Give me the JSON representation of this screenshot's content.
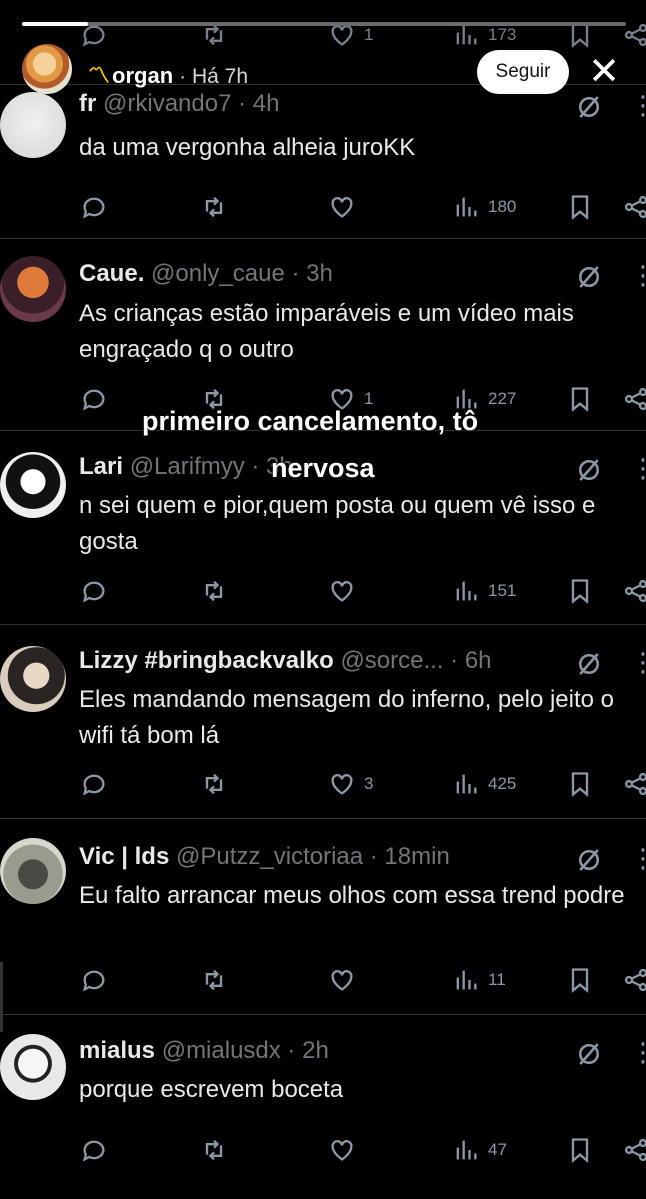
{
  "story": {
    "progress": 0.11,
    "user": "organ",
    "time": "· Há 7h",
    "follow": "Seguir",
    "close": "✕"
  },
  "top_partial": {
    "likes": "1",
    "views": "173"
  },
  "overlay": {
    "line1": "primeiro cancelamento, tô",
    "line2": "nervosa"
  },
  "tweets": [
    {
      "name": "fr",
      "handle": "@rkivando7 · 4h",
      "text": "da uma vergonha alheia juroKK",
      "likes": "",
      "views": "180"
    },
    {
      "name": "Caue.",
      "handle": "@only_caue · 3h",
      "text": "As crianças estão imparáveis e um vídeo mais engraçado q o outro",
      "likes": "1",
      "views": "227"
    },
    {
      "name": "Lari",
      "handle": "@Larifmyy · 3h",
      "text": "n sei quem e pior,quem posta ou quem vê isso e gosta",
      "likes": "",
      "views": "151"
    },
    {
      "name": "Lizzy #bringbackvalko",
      "handle": "@sorce... · 6h",
      "text": "Eles mandando mensagem do inferno, pelo jeito o wifi tá bom lá",
      "likes": "3",
      "views": "425"
    },
    {
      "name": "Vic | lds",
      "handle": "@Putzz_victoriaa · 18min",
      "text": "Eu falto arrancar meus olhos com essa trend podre",
      "likes": "",
      "views": "11"
    },
    {
      "name": "mialus",
      "handle": "@mialusdx · 2h",
      "text": "porque escrevem boceta",
      "likes": "",
      "views": "47"
    }
  ],
  "colors": {
    "background": "#000000",
    "text": "#e7e9ea",
    "muted": "#71767b",
    "divider": "#2f3336"
  }
}
